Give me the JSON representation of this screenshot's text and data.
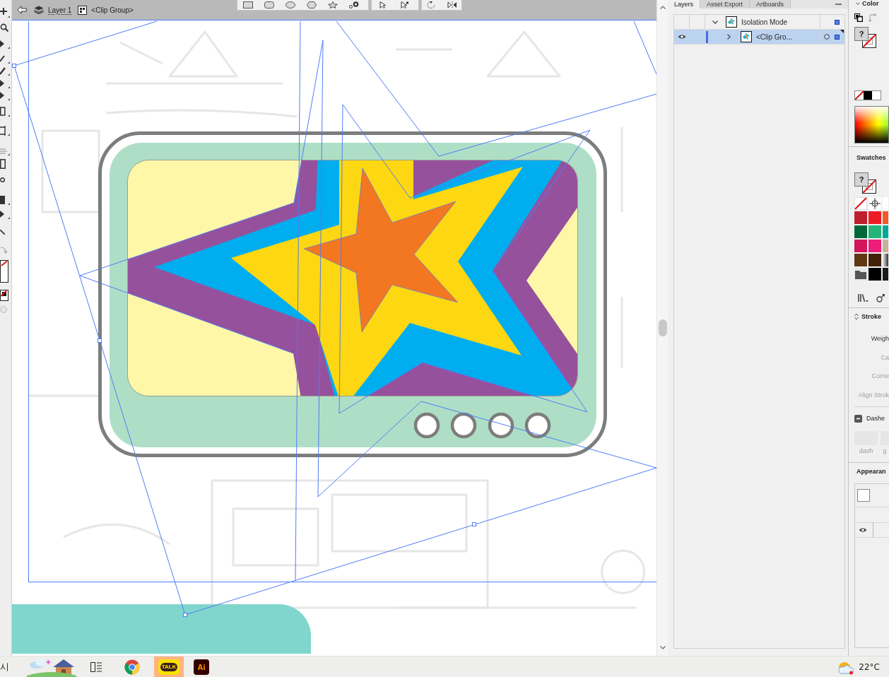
{
  "breadcrumb": {
    "items": [
      {
        "kind": "layer",
        "label": "Layer 1"
      },
      {
        "kind": "group",
        "label": "<Clip Group>"
      }
    ]
  },
  "layers_panel": {
    "tabs": [
      {
        "label": "Layers",
        "selected": true
      },
      {
        "label": "Asset Export",
        "selected": false
      },
      {
        "label": "Artboards",
        "selected": false
      }
    ],
    "layers": [
      {
        "name": "Isolation Mode",
        "selected": false,
        "expanded": true,
        "visible": false,
        "targeted": false,
        "art_selected": true,
        "children": [
          {
            "name": "<Clip Gro...",
            "selected": true,
            "expanded": false,
            "visible": true,
            "targeted": true,
            "art_selected": true
          }
        ]
      }
    ]
  },
  "right_panel": {
    "color": {
      "title": "Color",
      "fill_label": "?"
    },
    "swatches": {
      "title": "Swatches",
      "fill_label": "?",
      "items": [
        {
          "kind": "none"
        },
        {
          "kind": "registration"
        },
        {
          "kind": "color",
          "color": "#ffffff"
        },
        {
          "kind": "color",
          "color": "#be1e2d"
        },
        {
          "kind": "color",
          "color": "#ed1c24"
        },
        {
          "kind": "color",
          "color": "#f15a29"
        },
        {
          "kind": "color",
          "color": "#006838"
        },
        {
          "kind": "color",
          "color": "#25b57a"
        },
        {
          "kind": "color",
          "color": "#00a99d"
        },
        {
          "kind": "color",
          "color": "#d4145a"
        },
        {
          "kind": "color",
          "color": "#ed1e79"
        },
        {
          "kind": "color",
          "color": "#c7b299"
        },
        {
          "kind": "color",
          "color": "#603813"
        },
        {
          "kind": "color",
          "color": "#42210b"
        },
        {
          "kind": "gradient"
        },
        {
          "kind": "folder"
        },
        {
          "kind": "color",
          "color": "#000000"
        },
        {
          "kind": "color",
          "color": "#1a1a1a"
        }
      ]
    },
    "stroke": {
      "title": "Stroke",
      "rows": [
        {
          "label": "Weigh",
          "disabled": false
        },
        {
          "label": "Ca",
          "disabled": true
        },
        {
          "label": "Corne",
          "disabled": true
        },
        {
          "label": "Align Strok",
          "disabled": true
        }
      ],
      "dashed": {
        "label": "Dashe",
        "checked": true
      },
      "dash_fields": [
        {
          "label": "dash"
        },
        {
          "label": "g"
        }
      ]
    },
    "appearance": {
      "title": "Appearan",
      "visible": true
    }
  },
  "taskbar": {
    "search_text": "시",
    "apps": [
      {
        "kind": "widgets",
        "highlighted": false
      },
      {
        "kind": "task_view",
        "highlighted": false
      },
      {
        "kind": "browser",
        "highlighted": false
      },
      {
        "kind": "chat",
        "label": "TALK",
        "highlighted": true
      },
      {
        "kind": "design",
        "label": "Ai",
        "highlighted": false
      }
    ],
    "temperature": "22°C"
  }
}
